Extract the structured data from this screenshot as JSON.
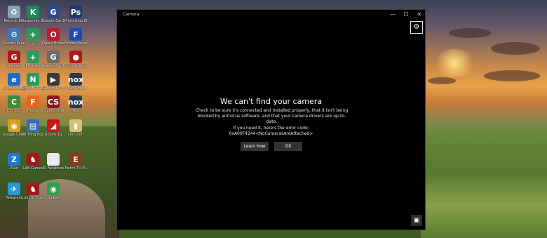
{
  "desktop": {
    "icons": [
      {
        "label": "Recycle Bin",
        "glyph": "♻",
        "color": "#8aa0b8"
      },
      {
        "label": "Kaspersky Secure Con...",
        "glyph": "K",
        "color": "#1b8a5a"
      },
      {
        "label": "Google Earth Pro",
        "glyph": "G",
        "color": "#2a4a8a"
      },
      {
        "label": "Photoshop Elements",
        "glyph": "Ps",
        "color": "#1c3a78"
      },
      {
        "label": "Control Panel",
        "glyph": "⚙",
        "color": "#3a7ab8"
      },
      {
        "label": "+",
        "glyph": "+",
        "color": "#2a9a5a"
      },
      {
        "label": "Opera Browser",
        "glyph": "O",
        "color": "#c0182a"
      },
      {
        "label": "Firefox Developer",
        "glyph": "F",
        "color": "#1a4ab8"
      },
      {
        "label": "Garena",
        "glyph": "G",
        "color": "#b01818"
      },
      {
        "label": "PC Suite",
        "glyph": "+",
        "color": "#2a9a5a"
      },
      {
        "label": "Google Earth Pro",
        "glyph": "G",
        "color": "#6a6a6a"
      },
      {
        "label": "CamStudio",
        "glyph": "●",
        "color": "#b01818"
      },
      {
        "label": "Microsoft Edge",
        "glyph": "e",
        "color": "#1a6ac8"
      },
      {
        "label": "Ngon FPT Play",
        "glyph": "N",
        "color": "#2a9a5a"
      },
      {
        "label": "Garena CF Fix",
        "glyph": "▶",
        "color": "#3a3a3a"
      },
      {
        "label": "Multi Drive",
        "glyph": "nox",
        "color": "#2a3a4a"
      },
      {
        "label": "Cốc Cốc",
        "glyph": "C",
        "color": "#3a8a3a"
      },
      {
        "label": "Firefox",
        "glyph": "F",
        "color": "#e8641a"
      },
      {
        "label": "Counter-Strike",
        "glyph": "CS",
        "color": "#8a1a1a"
      },
      {
        "label": "Nox",
        "glyph": "nox",
        "color": "#2a3a4a"
      },
      {
        "label": "Google Chrome",
        "glyph": "◉",
        "color": "#d8a020"
      },
      {
        "label": "00 Tổng hợp Hack Facebook",
        "glyph": "▤",
        "color": "#3a6ab8"
      },
      {
        "label": "D-com 3G",
        "glyph": "◢",
        "color": "#c81818"
      },
      {
        "label": "Linh tinh",
        "glyph": "▮",
        "color": "#d8c070"
      },
      {
        "label": "Zalo",
        "glyph": "Z",
        "color": "#1a7ad8"
      },
      {
        "label": "LAN Games",
        "glyph": "♞",
        "color": "#a01818"
      },
      {
        "label": "ID Facebook",
        "glyph": "▯",
        "color": "#e8e8e8"
      },
      {
        "label": "Twitch TV Plus",
        "glyph": "E",
        "color": "#8a3a1a"
      },
      {
        "label": "Telegram",
        "glyph": "✈",
        "color": "#2a9ad8"
      },
      {
        "label": "Lưu trữ Thuyết...",
        "glyph": "♞",
        "color": "#a01818"
      },
      {
        "label": "Unikey",
        "glyph": "◉",
        "color": "#2aa04a"
      }
    ]
  },
  "window": {
    "title": "Camera",
    "minimize": "—",
    "maximize": "☐",
    "close": "✕",
    "settings_glyph": "⚙",
    "error": {
      "title": "We can't find your camera",
      "body": "Check to be sure it's connected and installed properly, that it isn't being blocked by antivirus software, and that your camera drivers are up-to-date.",
      "code_label": "If you need it, here's the error code:",
      "code": "0xA00F4244<NoCamerasAreAttached>"
    },
    "buttons": {
      "learn_more": "Learn how",
      "ok": "OK"
    },
    "photo_glyph": "▣"
  }
}
